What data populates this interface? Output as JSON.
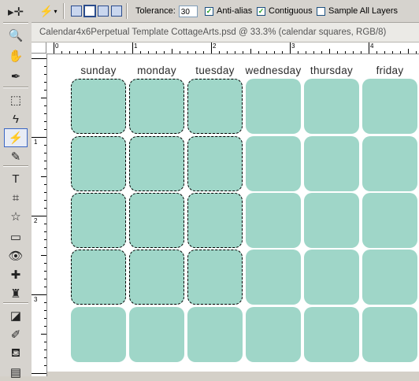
{
  "tools": [
    {
      "name": "move-tool",
      "glyph": "▸✛",
      "state": "normal"
    },
    {
      "name": "zoom-tool",
      "glyph": "🔍",
      "state": "normal"
    },
    {
      "name": "hand-tool",
      "glyph": "✋",
      "state": "normal"
    },
    {
      "name": "eyedropper-tool",
      "glyph": "✒",
      "state": "normal"
    },
    {
      "name": "marquee-tool",
      "glyph": "⬚",
      "state": "normal"
    },
    {
      "name": "lasso-tool",
      "glyph": "ϟ",
      "state": "normal"
    },
    {
      "name": "magic-wand-tool",
      "glyph": "⚡",
      "state": "active"
    },
    {
      "name": "pencil-tool",
      "glyph": "✎",
      "state": "normal"
    },
    {
      "name": "type-tool",
      "glyph": "T",
      "state": "normal"
    },
    {
      "name": "crop-tool",
      "glyph": "⌗",
      "state": "normal"
    },
    {
      "name": "shape-tool",
      "glyph": "☆",
      "state": "normal"
    },
    {
      "name": "monitor-tool",
      "glyph": "▭",
      "state": "normal"
    },
    {
      "name": "red-eye-tool",
      "glyph": "👁",
      "state": "normal"
    },
    {
      "name": "healing-brush-tool",
      "glyph": "✚",
      "state": "normal"
    },
    {
      "name": "stamp-tool",
      "glyph": "♜",
      "state": "normal"
    },
    {
      "name": "eraser-tool",
      "glyph": "◪",
      "state": "normal"
    },
    {
      "name": "brush-tool",
      "glyph": "✐",
      "state": "normal"
    },
    {
      "name": "paint-bucket-tool",
      "glyph": "⛾",
      "state": "normal"
    },
    {
      "name": "gradient-tool",
      "glyph": "▤",
      "state": "normal"
    }
  ],
  "options": {
    "tolerance_label": "Tolerance:",
    "tolerance_value": "30",
    "anti_alias_label": "Anti-alias",
    "anti_alias_checked": true,
    "contiguous_label": "Contiguous",
    "contiguous_checked": true,
    "sample_all_layers_label": "Sample All Layers",
    "sample_all_layers_checked": false
  },
  "document": {
    "title": "Calendar4x6Perpetual Template CottageArts.psd @ 33.3% (calendar squares, RGB/8)"
  },
  "ruler": {
    "h_labels": [
      "0",
      "1",
      "2",
      "3",
      "4"
    ],
    "v_labels": [
      "1",
      "2",
      "3"
    ]
  },
  "calendar": {
    "cell_color": "#9fd6c8",
    "days": [
      "sunday",
      "monday",
      "tuesday",
      "wednesday",
      "thursday",
      "friday"
    ],
    "rows": 5,
    "selected_columns": 3,
    "selected_rows": 4
  }
}
